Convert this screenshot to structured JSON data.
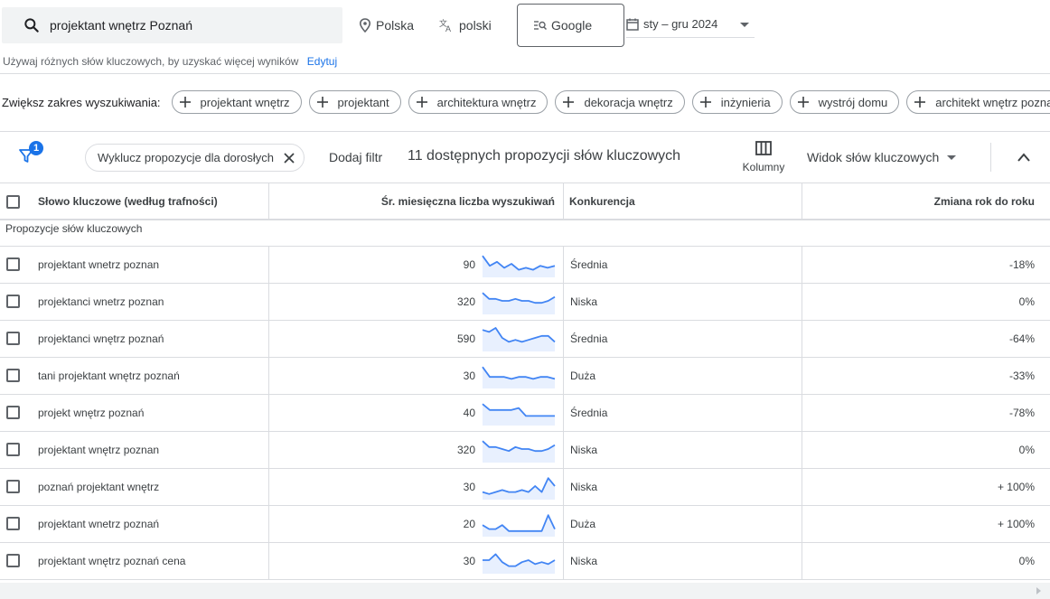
{
  "search": {
    "query": "projektant wnętrz Poznań"
  },
  "location": {
    "label": "Polska"
  },
  "language": {
    "label": "polski"
  },
  "engine": {
    "label": "Google"
  },
  "date_range": {
    "label": "sty – gru 2024"
  },
  "hint": {
    "text": "Używaj różnych słów kluczowych, by uzyskać więcej wyników",
    "edit_label": "Edytuj"
  },
  "broaden": {
    "label": "Zwiększ zakres wyszukiwania:",
    "chips": [
      "projektant wnętrz",
      "projektant",
      "architektura wnętrz",
      "dekoracja wnętrz",
      "inżynieria",
      "wystrój domu",
      "architekt wnętrz poznań"
    ]
  },
  "filters": {
    "badge": "1",
    "active_filter": "Wyklucz propozycje dla dorosłych",
    "add_filter": "Dodaj filtr",
    "count_text": "11 dostępnych propozycji słów kluczowych",
    "columns_label": "Kolumny",
    "view_label": "Widok słów kluczowych"
  },
  "table": {
    "headers": {
      "keyword": "Słowo kluczowe (według trafności)",
      "volume": "Śr. miesięczna liczba wyszukiwań",
      "competition": "Konkurencja",
      "yoy": "Zmiana rok do roku"
    },
    "group_label": "Propozycje słów kluczowych",
    "rows": [
      {
        "keyword": "projektant wnetrz poznan",
        "volume": "90",
        "competition": "Średnia",
        "yoy": "-18%",
        "trend": [
          9,
          4,
          6,
          3,
          5,
          2,
          3,
          2,
          4,
          3,
          4
        ]
      },
      {
        "keyword": "projektanci wnetrz poznan",
        "volume": "320",
        "competition": "Niska",
        "yoy": "0%",
        "trend": [
          9,
          6,
          6,
          5,
          5,
          6,
          5,
          5,
          4,
          4,
          5,
          7
        ]
      },
      {
        "keyword": "projektanci wnętrz poznań",
        "volume": "590",
        "competition": "Średnia",
        "yoy": "-64%",
        "trend": [
          9,
          8,
          10,
          5,
          3,
          4,
          3,
          4,
          5,
          6,
          6,
          3
        ]
      },
      {
        "keyword": "tani projektant wnętrz poznań",
        "volume": "30",
        "competition": "Duża",
        "yoy": "-33%",
        "trend": [
          9,
          4,
          4,
          4,
          3,
          4,
          4,
          3,
          4,
          4,
          3
        ]
      },
      {
        "keyword": "projekt wnętrz poznań",
        "volume": "40",
        "competition": "Średnia",
        "yoy": "-78%",
        "trend": [
          9,
          6,
          6,
          6,
          6,
          7,
          3,
          3,
          3,
          3,
          3
        ]
      },
      {
        "keyword": "projektant wnętrz poznan",
        "volume": "320",
        "competition": "Niska",
        "yoy": "0%",
        "trend": [
          9,
          6,
          6,
          5,
          4,
          6,
          5,
          5,
          4,
          4,
          5,
          7
        ]
      },
      {
        "keyword": "poznań projektant wnętrz",
        "volume": "30",
        "competition": "Niska",
        "yoy": "+ 100%",
        "trend": [
          2,
          1,
          2,
          3,
          2,
          2,
          3,
          2,
          5,
          2,
          9,
          5
        ]
      },
      {
        "keyword": "projektant wnetrz poznań",
        "volume": "20",
        "competition": "Duża",
        "yoy": "+ 100%",
        "trend": [
          4,
          2,
          2,
          4,
          1,
          1,
          1,
          1,
          1,
          1,
          9,
          2
        ]
      },
      {
        "keyword": "projektant wnętrz poznań cena",
        "volume": "30",
        "competition": "Niska",
        "yoy": "0%",
        "trend": [
          5,
          5,
          8,
          4,
          2,
          2,
          4,
          5,
          3,
          4,
          3,
          5
        ]
      }
    ]
  },
  "colors": {
    "accent": "#1a73e8",
    "sparkline": "#4285f4",
    "sparkline_fill": "#e8f0fe"
  }
}
